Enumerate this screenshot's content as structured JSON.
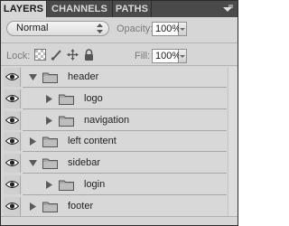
{
  "tabs": [
    {
      "label": "LAYERS",
      "active": true
    },
    {
      "label": "CHANNELS",
      "active": false
    },
    {
      "label": "PATHS",
      "active": false
    }
  ],
  "panel_menu_icon": "panel-menu-icon",
  "blend_mode": {
    "value": "Normal"
  },
  "opacity": {
    "label": "Opacity:",
    "value": "100%"
  },
  "lock": {
    "label": "Lock:",
    "icons": [
      "lock-transparent-pixels-icon",
      "lock-image-pixels-icon",
      "lock-position-icon",
      "lock-all-icon"
    ]
  },
  "fill": {
    "label": "Fill:",
    "value": "100%"
  },
  "layers": [
    {
      "name": "header",
      "depth": 0,
      "expanded": true,
      "visible": true
    },
    {
      "name": "logo",
      "depth": 1,
      "expanded": false,
      "visible": true
    },
    {
      "name": "navigation",
      "depth": 1,
      "expanded": false,
      "visible": true
    },
    {
      "name": "left content",
      "depth": 0,
      "expanded": false,
      "visible": true
    },
    {
      "name": "sidebar",
      "depth": 0,
      "expanded": true,
      "visible": true
    },
    {
      "name": "login",
      "depth": 1,
      "expanded": false,
      "visible": true
    },
    {
      "name": "footer",
      "depth": 0,
      "expanded": false,
      "visible": true
    }
  ],
  "colors": {
    "tab_bar": "#4a4a4a",
    "panel_bg": "#d6d6d6"
  }
}
